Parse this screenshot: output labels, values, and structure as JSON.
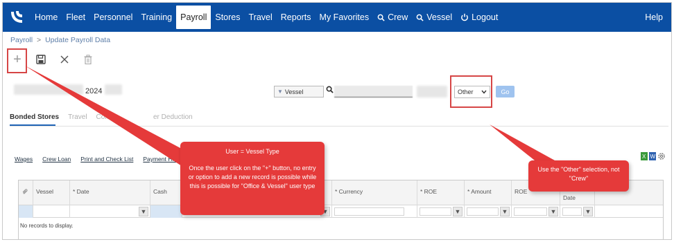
{
  "nav": {
    "items": [
      "Home",
      "Fleet",
      "Personnel",
      "Training",
      "Payroll",
      "Stores",
      "Travel",
      "Reports",
      "My Favorites"
    ],
    "active": "Payroll",
    "crew_search": "Crew",
    "vessel_search": "Vessel",
    "logout": "Logout",
    "help": "Help"
  },
  "breadcrumb": {
    "root": "Payroll",
    "current": "Update Payroll Data"
  },
  "filters": {
    "year": "2024",
    "scope_select": "Vessel",
    "type_select": "Other",
    "go_label": "Go"
  },
  "tabs": [
    "Bonded Stores",
    "Travel",
    "Comm",
    "er Deduction"
  ],
  "links": [
    "Wages",
    "Crew Loan",
    "Print and Check List",
    "Payment History"
  ],
  "grid": {
    "columns": [
      "Vessel",
      "* Date",
      "Cash",
      "* Currency",
      "* ROE",
      "* Amount",
      "ROE",
      "Date"
    ],
    "empty_text": "No records to display."
  },
  "callouts": {
    "main_title": "User = Vessel Type",
    "main_body": "Once the user click on the \"+\" button, no entry or option to add a new record is possible while this is possible for \"Office & Vessel\" user type",
    "side_body": "Use  the \"Other\" selection, not \"Crew\""
  },
  "colors": {
    "navbar": "#0b4fa3",
    "callout": "#e53a3a",
    "highlight_box": "#d64545",
    "tab_underline": "#1e63b5"
  }
}
